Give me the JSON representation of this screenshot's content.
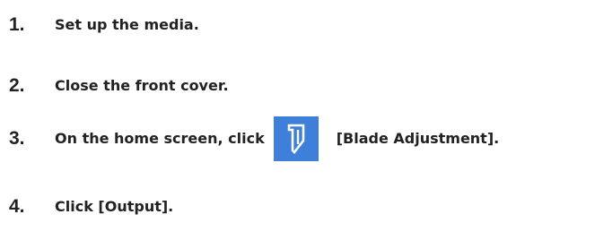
{
  "steps": [
    {
      "number": "1.",
      "text": "Set up the media."
    },
    {
      "number": "2.",
      "text": "Close the front cover."
    },
    {
      "number": "3.",
      "text_before": "On the home screen, click",
      "button_icon": "blade-adjustment-icon",
      "text_after": "[Blade Adjustment]."
    },
    {
      "number": "4.",
      "text": "Click [Output]."
    }
  ],
  "colors": {
    "text": "#222222",
    "icon_background": "#3d7fd9",
    "icon_glyph": "#ffffff"
  }
}
